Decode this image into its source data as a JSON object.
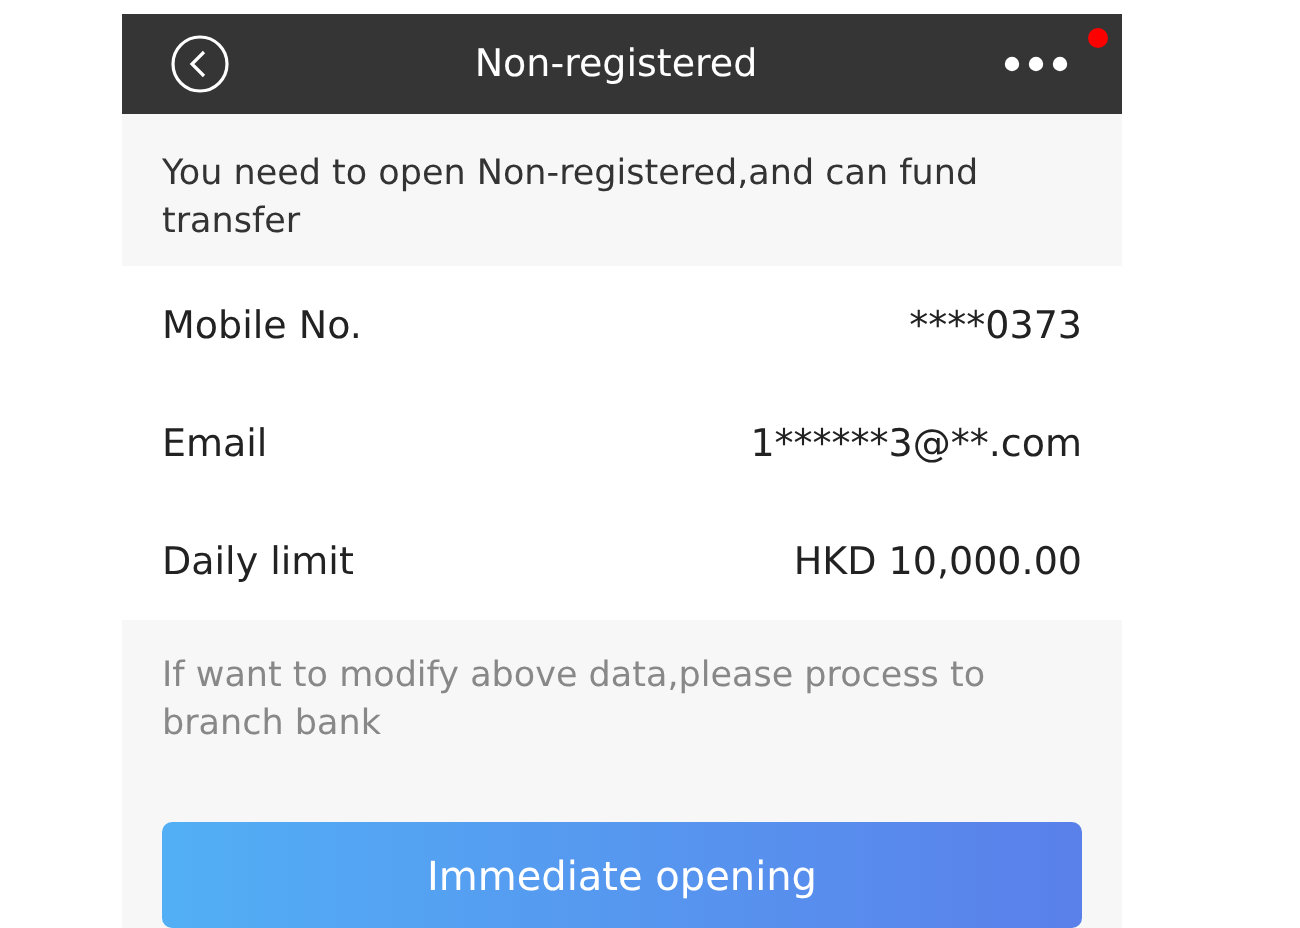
{
  "header": {
    "title": "Non-registered",
    "menu_badge": true
  },
  "notice": "You need to open Non-registered,and can fund transfer",
  "rows": [
    {
      "label": "Mobile No.",
      "value": "****0373"
    },
    {
      "label": "Email",
      "value": "1******3@**.com"
    },
    {
      "label": "Daily limit",
      "value": "HKD 10,000.00"
    }
  ],
  "hint": "If want to modify above data,please process to branch bank",
  "button": "Immediate opening"
}
